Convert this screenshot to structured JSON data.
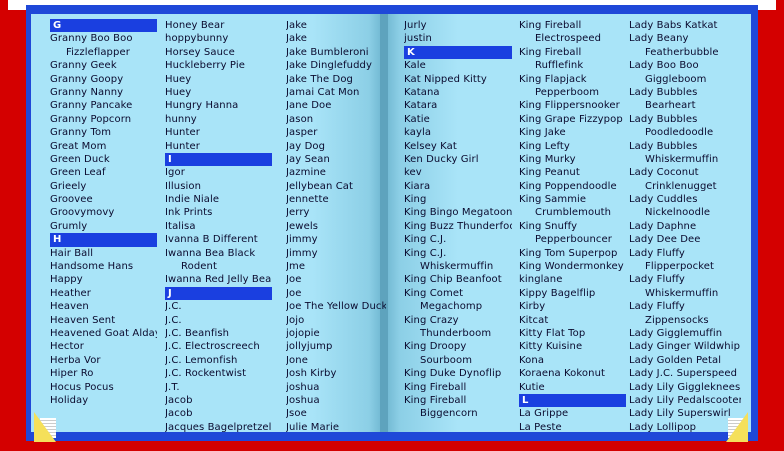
{
  "columns": [
    {
      "id": "col1",
      "rows": [
        {
          "t": "G",
          "type": "header"
        },
        {
          "t": "Granny Boo Boo"
        },
        {
          "t": "Fizzleflapper",
          "indent": true
        },
        {
          "t": "Granny Geek"
        },
        {
          "t": "Granny Goopy"
        },
        {
          "t": "Granny Nanny"
        },
        {
          "t": "Granny Pancake"
        },
        {
          "t": "Granny Popcorn"
        },
        {
          "t": "Granny Tom"
        },
        {
          "t": "Great Mom"
        },
        {
          "t": "Green Duck"
        },
        {
          "t": "Green Leaf"
        },
        {
          "t": "Grieely"
        },
        {
          "t": "Groovee"
        },
        {
          "t": "Groovymovy"
        },
        {
          "t": "Grumly"
        },
        {
          "t": "H",
          "type": "header"
        },
        {
          "t": "Hair Ball"
        },
        {
          "t": "Handsome Hans"
        },
        {
          "t": "Happy"
        },
        {
          "t": "Heather"
        },
        {
          "t": "Heaven"
        },
        {
          "t": "Heaven Sent"
        },
        {
          "t": "Heavened Goat Alday"
        },
        {
          "t": "Hector"
        },
        {
          "t": "Herba Vor"
        },
        {
          "t": "Hiper Ro"
        },
        {
          "t": "Hocus Pocus"
        },
        {
          "t": "Holiday"
        }
      ]
    },
    {
      "id": "col2",
      "rows": [
        {
          "t": "Honey Bear"
        },
        {
          "t": "hoppybunny"
        },
        {
          "t": "Horsey Sauce"
        },
        {
          "t": "Huckleberry Pie"
        },
        {
          "t": "Huey"
        },
        {
          "t": "Huey"
        },
        {
          "t": "Hungry Hanna"
        },
        {
          "t": "hunny"
        },
        {
          "t": "Hunter"
        },
        {
          "t": "Hunter"
        },
        {
          "t": "I",
          "type": "header"
        },
        {
          "t": "Igor"
        },
        {
          "t": "Illusion"
        },
        {
          "t": "Indie Niale"
        },
        {
          "t": "Ink Prints"
        },
        {
          "t": "Italisa"
        },
        {
          "t": "Ivanna B Different"
        },
        {
          "t": "Iwanna Bea Black"
        },
        {
          "t": "Rodent",
          "indent": true
        },
        {
          "t": "Iwanna Red Jelly Bean"
        },
        {
          "t": "J",
          "type": "header"
        },
        {
          "t": "J.C."
        },
        {
          "t": "J.C."
        },
        {
          "t": "J.C. Beanfish"
        },
        {
          "t": "J.C. Electroscreech"
        },
        {
          "t": "J.C. Lemonfish"
        },
        {
          "t": "J.C. Rockentwist"
        },
        {
          "t": "J.T."
        },
        {
          "t": "Jacob"
        },
        {
          "t": "Jacob"
        },
        {
          "t": "Jacques Bagelpretzel"
        }
      ]
    },
    {
      "id": "col3",
      "rows": [
        {
          "t": "Jake"
        },
        {
          "t": "Jake"
        },
        {
          "t": "Jake Bumbleroni"
        },
        {
          "t": "Jake Dinglefuddy"
        },
        {
          "t": "Jake The Dog"
        },
        {
          "t": "Jamai Cat Mon"
        },
        {
          "t": "Jane Doe"
        },
        {
          "t": "Jason"
        },
        {
          "t": "Jasper"
        },
        {
          "t": "Jay Dog"
        },
        {
          "t": "Jay Sean"
        },
        {
          "t": "Jazmine"
        },
        {
          "t": "Jellybean Cat"
        },
        {
          "t": "Jennette"
        },
        {
          "t": "Jerry"
        },
        {
          "t": "Jewels"
        },
        {
          "t": "Jimmy"
        },
        {
          "t": "Jimmy"
        },
        {
          "t": "Jme"
        },
        {
          "t": "Joe"
        },
        {
          "t": "Joe"
        },
        {
          "t": "Joe The Yellow Duck"
        },
        {
          "t": "Jojo"
        },
        {
          "t": "jojopie"
        },
        {
          "t": "jollyjump"
        },
        {
          "t": "Jone"
        },
        {
          "t": "Josh Kirby"
        },
        {
          "t": "joshua"
        },
        {
          "t": "Joshua"
        },
        {
          "t": "Jsoe"
        },
        {
          "t": "Julie Marie"
        }
      ]
    },
    {
      "id": "col4",
      "rows": [
        {
          "t": "Jurly"
        },
        {
          "t": "justin"
        },
        {
          "t": "K",
          "type": "header"
        },
        {
          "t": "Kale"
        },
        {
          "t": "Kat Nipped Kitty"
        },
        {
          "t": "Katana"
        },
        {
          "t": "Katara"
        },
        {
          "t": "Katie"
        },
        {
          "t": "kayla"
        },
        {
          "t": "Kelsey Kat"
        },
        {
          "t": "Ken Ducky Girl"
        },
        {
          "t": "kev"
        },
        {
          "t": "Kiara"
        },
        {
          "t": "King"
        },
        {
          "t": "King Bingo Megatoon"
        },
        {
          "t": "King Buzz Thunderfoot"
        },
        {
          "t": "King C.J."
        },
        {
          "t": "King C.J."
        },
        {
          "t": "Whiskermuffin",
          "indent": true
        },
        {
          "t": "King Chip Beanfoot"
        },
        {
          "t": "King Comet"
        },
        {
          "t": "Megachomp",
          "indent": true
        },
        {
          "t": "King Crazy"
        },
        {
          "t": "Thunderboom",
          "indent": true
        },
        {
          "t": "King Droopy"
        },
        {
          "t": "Sourboom",
          "indent": true
        },
        {
          "t": "King Duke Dynoflip"
        },
        {
          "t": "King Fireball"
        },
        {
          "t": "King Fireball"
        },
        {
          "t": "Biggencorn",
          "indent": true
        }
      ]
    },
    {
      "id": "col5",
      "rows": [
        {
          "t": "King Fireball"
        },
        {
          "t": "Electrospeed",
          "indent": true
        },
        {
          "t": "King Fireball"
        },
        {
          "t": "Rufflefink",
          "indent": true
        },
        {
          "t": "King Flapjack"
        },
        {
          "t": "Pepperboom",
          "indent": true
        },
        {
          "t": "King Flippersnooker"
        },
        {
          "t": "King Grape Fizzypop"
        },
        {
          "t": "King Jake"
        },
        {
          "t": "King Lefty"
        },
        {
          "t": "King Murky"
        },
        {
          "t": "King Peanut"
        },
        {
          "t": "King Poppendoodle"
        },
        {
          "t": "King Sammie"
        },
        {
          "t": "Crumblemouth",
          "indent": true
        },
        {
          "t": "King Snuffy"
        },
        {
          "t": "Pepperbouncer",
          "indent": true
        },
        {
          "t": "King Tom Superpop"
        },
        {
          "t": "King Wondermonkey"
        },
        {
          "t": "kinglane"
        },
        {
          "t": "Kippy Bagelflip"
        },
        {
          "t": "Kirby"
        },
        {
          "t": "Kitcat"
        },
        {
          "t": "Kitty Flat Top"
        },
        {
          "t": "Kitty Kuisine"
        },
        {
          "t": "Kona"
        },
        {
          "t": "Koraena Kokonut"
        },
        {
          "t": "Kutie"
        },
        {
          "t": "L",
          "type": "header"
        },
        {
          "t": "La Grippe"
        },
        {
          "t": "La Peste"
        }
      ]
    },
    {
      "id": "col6",
      "rows": [
        {
          "t": "Lady Babs Katkat"
        },
        {
          "t": "Lady Beany"
        },
        {
          "t": "Featherbubble",
          "indent": true
        },
        {
          "t": "Lady Boo Boo"
        },
        {
          "t": "Giggleboom",
          "indent": true
        },
        {
          "t": "Lady Bubbles"
        },
        {
          "t": "Bearheart",
          "indent": true
        },
        {
          "t": "Lady Bubbles"
        },
        {
          "t": "Poodledoodle",
          "indent": true
        },
        {
          "t": "Lady Bubbles"
        },
        {
          "t": "Whiskermuffin",
          "indent": true
        },
        {
          "t": "Lady Coconut"
        },
        {
          "t": "Crinklenugget",
          "indent": true
        },
        {
          "t": "Lady Cuddles"
        },
        {
          "t": "Nickelnoodle",
          "indent": true
        },
        {
          "t": "Lady Daphne"
        },
        {
          "t": "Lady Dee Dee"
        },
        {
          "t": "Lady Fluffy"
        },
        {
          "t": "Flipperpocket",
          "indent": true
        },
        {
          "t": "Lady Fluffy"
        },
        {
          "t": "Whiskermuffin",
          "indent": true
        },
        {
          "t": "Lady Fluffy"
        },
        {
          "t": "Zippensocks",
          "indent": true
        },
        {
          "t": "Lady Gigglemuffin"
        },
        {
          "t": "Lady Ginger Wildwhip"
        },
        {
          "t": "Lady Golden Petal"
        },
        {
          "t": "Lady J.C. Superspeed"
        },
        {
          "t": "Lady Lily Giggleknees"
        },
        {
          "t": "Lady Lily Pedalscooter"
        },
        {
          "t": "Lady Lily Superswirl"
        },
        {
          "t": "Lady Lollipop"
        }
      ]
    }
  ]
}
